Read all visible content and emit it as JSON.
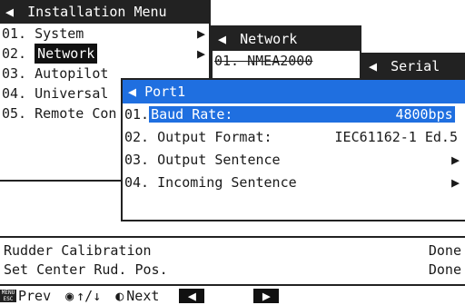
{
  "installation_menu": {
    "title": "Installation Menu",
    "items": [
      {
        "num": "01.",
        "label": "System",
        "arrow": "▶"
      },
      {
        "num": "02.",
        "label": "Network",
        "arrow": "▶"
      },
      {
        "num": "03.",
        "label": "Autopilot",
        "arrow": ""
      },
      {
        "num": "04.",
        "label": "Universal",
        "arrow": ""
      },
      {
        "num": "05.",
        "label": "Remote Con",
        "arrow": ""
      }
    ]
  },
  "network_menu": {
    "title": "Network",
    "first_item": "01. NMEA2000"
  },
  "serial_menu": {
    "title": "Serial"
  },
  "port_menu": {
    "title": "Port1",
    "items": [
      {
        "num": "01.",
        "label": "Baud Rate:",
        "value": "4800bps"
      },
      {
        "num": "02.",
        "label": "Output Format:",
        "value": "IEC61162-1 Ed.5"
      },
      {
        "num": "03.",
        "label": "Output Sentence",
        "value": "▶"
      },
      {
        "num": "04.",
        "label": "Incoming Sentence",
        "value": "▶"
      }
    ]
  },
  "status": [
    {
      "label": "Rudder Calibration",
      "value": "Done"
    },
    {
      "label": "Set Center Rud. Pos.",
      "value": "Done"
    }
  ],
  "footer": {
    "menu_icon_text": "MENU ESC",
    "prev": "Prev",
    "updown": "↑/↓",
    "next": "Next",
    "left_glyph": "◀",
    "right_glyph": "▶"
  },
  "colors": {
    "highlight": "#1f6fe0",
    "frame": "#222222"
  }
}
